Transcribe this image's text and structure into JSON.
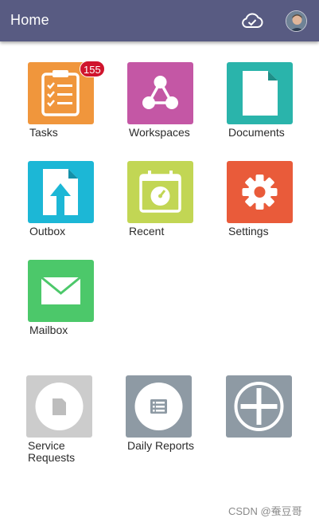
{
  "header": {
    "title": "Home"
  },
  "colors": {
    "header": "#585b82",
    "tasks": "#f0963c",
    "workspaces": "#c457a5",
    "documents": "#2ab4ab",
    "outbox": "#1cb7d6",
    "recent": "#c2d654",
    "settings": "#e95b3a",
    "mailbox": "#4cc86a",
    "service_requests": "#cccccc",
    "daily_reports": "#8e9aa4",
    "add": "#8e9aa4",
    "badge": "#d0142c"
  },
  "tiles": [
    {
      "label": "Tasks",
      "icon": "clipboard-checklist-icon",
      "badge": "155"
    },
    {
      "label": "Workspaces",
      "icon": "network-nodes-icon"
    },
    {
      "label": "Documents",
      "icon": "document-icon"
    },
    {
      "label": "Outbox",
      "icon": "upload-file-icon"
    },
    {
      "label": "Recent",
      "icon": "calendar-gauge-icon"
    },
    {
      "label": "Settings",
      "icon": "gear-icon"
    },
    {
      "label": "Mailbox",
      "icon": "envelope-icon"
    }
  ],
  "shortcuts": [
    {
      "label": "Service Requests",
      "icon": "file-circle-icon"
    },
    {
      "label": "Daily Reports",
      "icon": "list-circle-icon"
    },
    {
      "label": "",
      "icon": "plus-icon"
    }
  ],
  "watermark": "CSDN @蚕豆哥"
}
